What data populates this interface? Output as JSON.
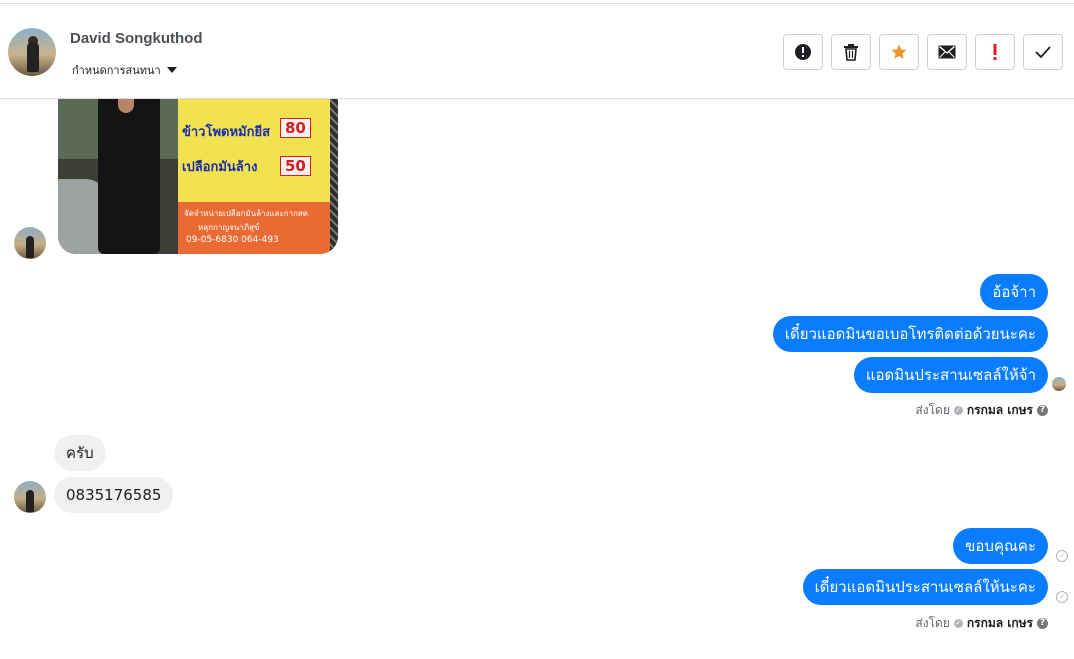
{
  "header": {
    "name": "David Songkuthod",
    "assign_label": "กำหนดการสนทนา",
    "actions": [
      "report",
      "delete",
      "star",
      "unread",
      "important",
      "done"
    ]
  },
  "photo": {
    "sign_line1": "ข้าวโพดหมักยีส",
    "price1": "80",
    "sign_line2": "เปลือกมันล้าง",
    "price2": "50",
    "sign_small1": "จัดจำหน่ายเปลือกมันล้างและกากสด",
    "sign_small2": "หลุกกาญจนาภิสุข์",
    "sign_phone": "09-05-6830 064-493"
  },
  "messages_out_1": [
    "อ้อจ้าา",
    "เดี๋ยวแอดมินขอเบอโทรติดต่อด้วยนะคะ",
    "แอดมินประสานเซลล์ให้จ้า"
  ],
  "sent_by_1": {
    "prefix": "ส่งโดย",
    "who": "กรกมล เกษร"
  },
  "messages_in": [
    "ครับ",
    "0835176585"
  ],
  "messages_out_2": [
    "ขอบคุณคะ",
    "เดี๋ยวแอดมินประสานเซลล์ให้นะคะ"
  ],
  "sent_by_2": {
    "prefix": "ส่งโดย",
    "who": "กรกมล เกษร"
  },
  "colors": {
    "outgoing": "#0a7cff",
    "incoming": "#f0f0f0",
    "star": "#f0932b",
    "important": "#e02020"
  },
  "icons": {
    "report": "exclamation-circle-icon",
    "delete": "trash-icon",
    "star": "star-icon",
    "unread": "envelope-icon",
    "important": "exclamation-icon",
    "done": "check-icon"
  }
}
